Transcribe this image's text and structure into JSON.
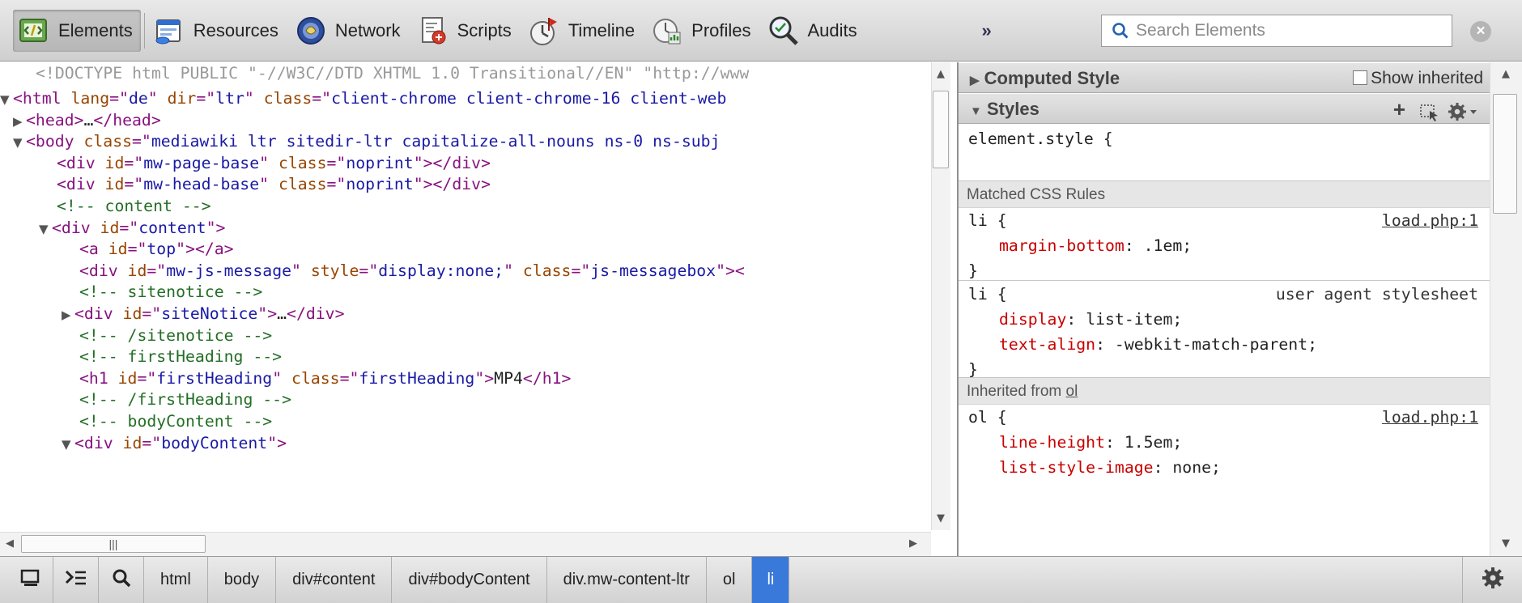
{
  "toolbar": {
    "panels": [
      {
        "label": "Elements",
        "icon": "elements-icon"
      },
      {
        "label": "Resources",
        "icon": "resources-icon"
      },
      {
        "label": "Network",
        "icon": "network-icon"
      },
      {
        "label": "Scripts",
        "icon": "scripts-icon"
      },
      {
        "label": "Timeline",
        "icon": "timeline-icon"
      },
      {
        "label": "Profiles",
        "icon": "profiles-icon"
      },
      {
        "label": "Audits",
        "icon": "audits-icon"
      }
    ],
    "overflow_label": "»",
    "search_placeholder": "Search Elements",
    "close_label": "×"
  },
  "tree": {
    "doctype": "<!DOCTYPE html PUBLIC \"-//W3C//DTD XHTML 1.0 Transitional//EN\" \"http://www",
    "lines": [
      {
        "tri": "▼",
        "parts": [
          [
            "tag",
            "<html "
          ],
          [
            "attr",
            "lang"
          ],
          [
            "tag",
            "=\""
          ],
          [
            "val",
            "de"
          ],
          [
            "tag",
            "\" "
          ],
          [
            "attr",
            "dir"
          ],
          [
            "tag",
            "=\""
          ],
          [
            "val",
            "ltr"
          ],
          [
            "tag",
            "\" "
          ],
          [
            "attr",
            "class"
          ],
          [
            "tag",
            "=\""
          ],
          [
            "val",
            "client-chrome client-chrome-16 client-web"
          ]
        ]
      },
      {
        "tri": "▶",
        "parts": [
          [
            "tag",
            "<head>"
          ],
          [
            "txt",
            "…"
          ],
          [
            "tag",
            "</head>"
          ]
        ]
      },
      {
        "tri": "▼",
        "parts": [
          [
            "tag",
            "<body "
          ],
          [
            "attr",
            "class"
          ],
          [
            "tag",
            "=\""
          ],
          [
            "val",
            "mediawiki ltr sitedir-ltr capitalize-all-nouns ns-0 ns-subj"
          ]
        ]
      },
      {
        "tri": "",
        "parts": [
          [
            "tag",
            "<div "
          ],
          [
            "attr",
            "id"
          ],
          [
            "tag",
            "=\""
          ],
          [
            "val",
            "mw-page-base"
          ],
          [
            "tag",
            "\" "
          ],
          [
            "attr",
            "class"
          ],
          [
            "tag",
            "=\""
          ],
          [
            "val",
            "noprint"
          ],
          [
            "tag",
            "\"></div>"
          ]
        ]
      },
      {
        "tri": "",
        "parts": [
          [
            "tag",
            "<div "
          ],
          [
            "attr",
            "id"
          ],
          [
            "tag",
            "=\""
          ],
          [
            "val",
            "mw-head-base"
          ],
          [
            "tag",
            "\" "
          ],
          [
            "attr",
            "class"
          ],
          [
            "tag",
            "=\""
          ],
          [
            "val",
            "noprint"
          ],
          [
            "tag",
            "\"></div>"
          ]
        ]
      },
      {
        "tri": "",
        "parts": [
          [
            "cmt",
            "<!-- content -->"
          ]
        ]
      },
      {
        "tri": "▼",
        "parts": [
          [
            "tag",
            "<div "
          ],
          [
            "attr",
            "id"
          ],
          [
            "tag",
            "=\""
          ],
          [
            "val",
            "content"
          ],
          [
            "tag",
            "\">"
          ]
        ]
      },
      {
        "tri": "",
        "parts": [
          [
            "tag",
            "<a "
          ],
          [
            "attr",
            "id"
          ],
          [
            "tag",
            "=\""
          ],
          [
            "val",
            "top"
          ],
          [
            "tag",
            "\"></a>"
          ]
        ]
      },
      {
        "tri": "",
        "parts": [
          [
            "tag",
            "<div "
          ],
          [
            "attr",
            "id"
          ],
          [
            "tag",
            "=\""
          ],
          [
            "val",
            "mw-js-message"
          ],
          [
            "tag",
            "\" "
          ],
          [
            "attr",
            "style"
          ],
          [
            "tag",
            "=\""
          ],
          [
            "val",
            "display:none;"
          ],
          [
            "tag",
            "\" "
          ],
          [
            "attr",
            "class"
          ],
          [
            "tag",
            "=\""
          ],
          [
            "val",
            "js-messagebox"
          ],
          [
            "tag",
            "\"><"
          ]
        ]
      },
      {
        "tri": "",
        "parts": [
          [
            "cmt",
            "<!-- sitenotice -->"
          ]
        ]
      },
      {
        "tri": "▶",
        "parts": [
          [
            "tag",
            "<div "
          ],
          [
            "attr",
            "id"
          ],
          [
            "tag",
            "=\""
          ],
          [
            "val",
            "siteNotice"
          ],
          [
            "tag",
            "\">"
          ],
          [
            "txt",
            "…"
          ],
          [
            "tag",
            "</div>"
          ]
        ]
      },
      {
        "tri": "",
        "parts": [
          [
            "cmt",
            "<!-- /sitenotice -->"
          ]
        ]
      },
      {
        "tri": "",
        "parts": [
          [
            "cmt",
            "<!-- firstHeading -->"
          ]
        ]
      },
      {
        "tri": "",
        "parts": [
          [
            "tag",
            "<h1 "
          ],
          [
            "attr",
            "id"
          ],
          [
            "tag",
            "=\""
          ],
          [
            "val",
            "firstHeading"
          ],
          [
            "tag",
            "\" "
          ],
          [
            "attr",
            "class"
          ],
          [
            "tag",
            "=\""
          ],
          [
            "val",
            "firstHeading"
          ],
          [
            "tag",
            "\">"
          ],
          [
            "txt",
            "MP4"
          ],
          [
            "tag",
            "</h1>"
          ]
        ]
      },
      {
        "tri": "",
        "parts": [
          [
            "cmt",
            "<!-- /firstHeading -->"
          ]
        ]
      },
      {
        "tri": "",
        "parts": [
          [
            "cmt",
            "<!-- bodyContent -->"
          ]
        ]
      },
      {
        "tri": "▼",
        "parts": [
          [
            "tag",
            "<div "
          ],
          [
            "attr",
            "id"
          ],
          [
            "tag",
            "=\""
          ],
          [
            "val",
            "bodyContent"
          ],
          [
            "tag",
            "\">"
          ]
        ]
      }
    ]
  },
  "sidebar": {
    "computed_title": "Computed Style",
    "show_inherited_label": "Show inherited",
    "styles_title": "Styles",
    "element_style_open": "element.style {",
    "close_brace": "}",
    "matched_rules_label": "Matched CSS Rules",
    "rule1": {
      "selector": "li {",
      "source": "load.php:1",
      "props": [
        {
          "name": "margin-bottom",
          "value": ": .1em;"
        }
      ]
    },
    "rule2": {
      "selector": "li {",
      "origin": "user agent stylesheet",
      "props": [
        {
          "name": "display",
          "value": ": list-item;"
        },
        {
          "name": "text-align",
          "value": ": -webkit-match-parent;"
        }
      ]
    },
    "inherited_prefix": "Inherited from ",
    "inherited_from": "ol",
    "rule3": {
      "selector": "ol {",
      "source": "load.php:1",
      "props": [
        {
          "name": "line-height",
          "value": ": 1.5em;"
        },
        {
          "name": "list-style-image",
          "value": ": none;"
        }
      ]
    }
  },
  "statusbar": {
    "breadcrumbs": [
      "html",
      "body",
      "div#content",
      "div#bodyContent",
      "div.mw-content-ltr",
      "ol",
      "li"
    ],
    "selected_crumb": "li"
  },
  "colors": {
    "tag": "#881280",
    "attribute": "#994500",
    "value": "#1a1aa6",
    "comment": "#236e25",
    "property": "#c80000",
    "selection": "#3879d9"
  }
}
